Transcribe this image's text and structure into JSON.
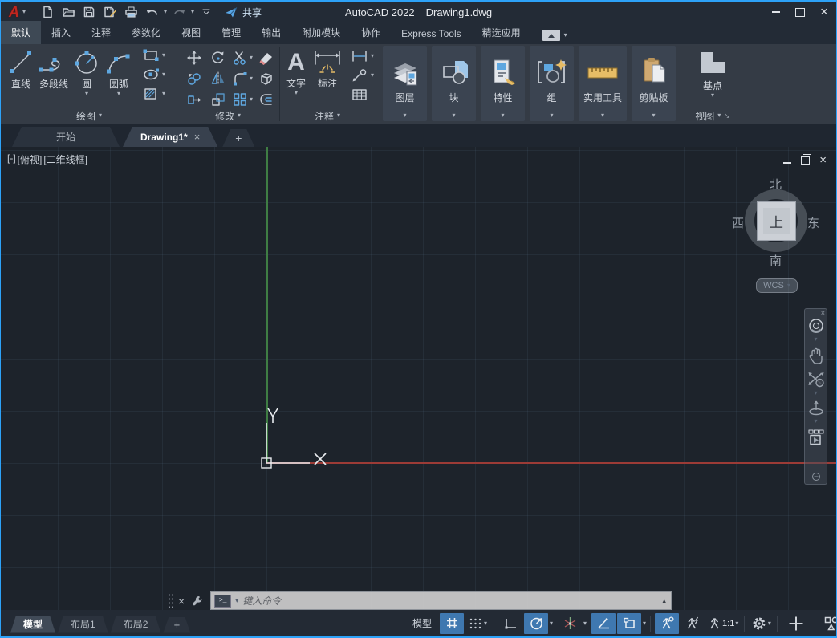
{
  "titlebar": {
    "logo_letter": "A",
    "app_title": "AutoCAD 2022",
    "doc_title": "Drawing1.dwg",
    "share_label": "共享"
  },
  "ribbon": {
    "tabs": [
      {
        "label": "默认",
        "active": true
      },
      {
        "label": "插入"
      },
      {
        "label": "注释"
      },
      {
        "label": "参数化"
      },
      {
        "label": "视图"
      },
      {
        "label": "管理"
      },
      {
        "label": "输出"
      },
      {
        "label": "附加模块"
      },
      {
        "label": "协作"
      },
      {
        "label": "Express Tools"
      },
      {
        "label": "精选应用"
      }
    ],
    "panels": {
      "draw": {
        "label": "绘图",
        "line": "直线",
        "polyline": "多段线",
        "circle": "圆",
        "arc": "圆弧"
      },
      "modify": {
        "label": "修改"
      },
      "annotation": {
        "label": "注释",
        "text": "文字",
        "dimension": "标注"
      },
      "layers": {
        "label": "图层"
      },
      "block": {
        "label": "块"
      },
      "properties": {
        "label": "特性"
      },
      "groups": {
        "label": "组"
      },
      "utilities": {
        "label": "实用工具"
      },
      "clipboard": {
        "label": "剪贴板"
      },
      "basepoint": {
        "label": "基点"
      },
      "view": {
        "label": "视图"
      }
    }
  },
  "file_tabs": {
    "start": "开始",
    "drawing": "Drawing1*"
  },
  "viewport": {
    "controls": {
      "menu": "[-]",
      "view": "[俯视]",
      "visual_style": "[二维线框]"
    }
  },
  "viewcube": {
    "north": "北",
    "west": "西",
    "east": "东",
    "south": "南",
    "top": "上",
    "wcs": "WCS"
  },
  "command_line": {
    "placeholder": "键入命令",
    "prompt_glyph": ">_"
  },
  "layout_tabs": {
    "model": "模型",
    "layout1": "布局1",
    "layout2": "布局2"
  },
  "status_bar": {
    "model_space": "模型",
    "annotation_scale": "1:1"
  },
  "icons": {
    "dropdown": "▾",
    "scroll_up": "▲",
    "close": "×",
    "plus": "+",
    "text_tool": "A",
    "launcher": "↘"
  },
  "colors": {
    "accent_blue": "#5ea7e0",
    "highlight_blue": "#3f78b0",
    "warning_yellow": "#e7bd66",
    "axis_red": "#9c3b36",
    "axis_green": "#3f7d44",
    "frame_blue": "#2da2f8"
  }
}
